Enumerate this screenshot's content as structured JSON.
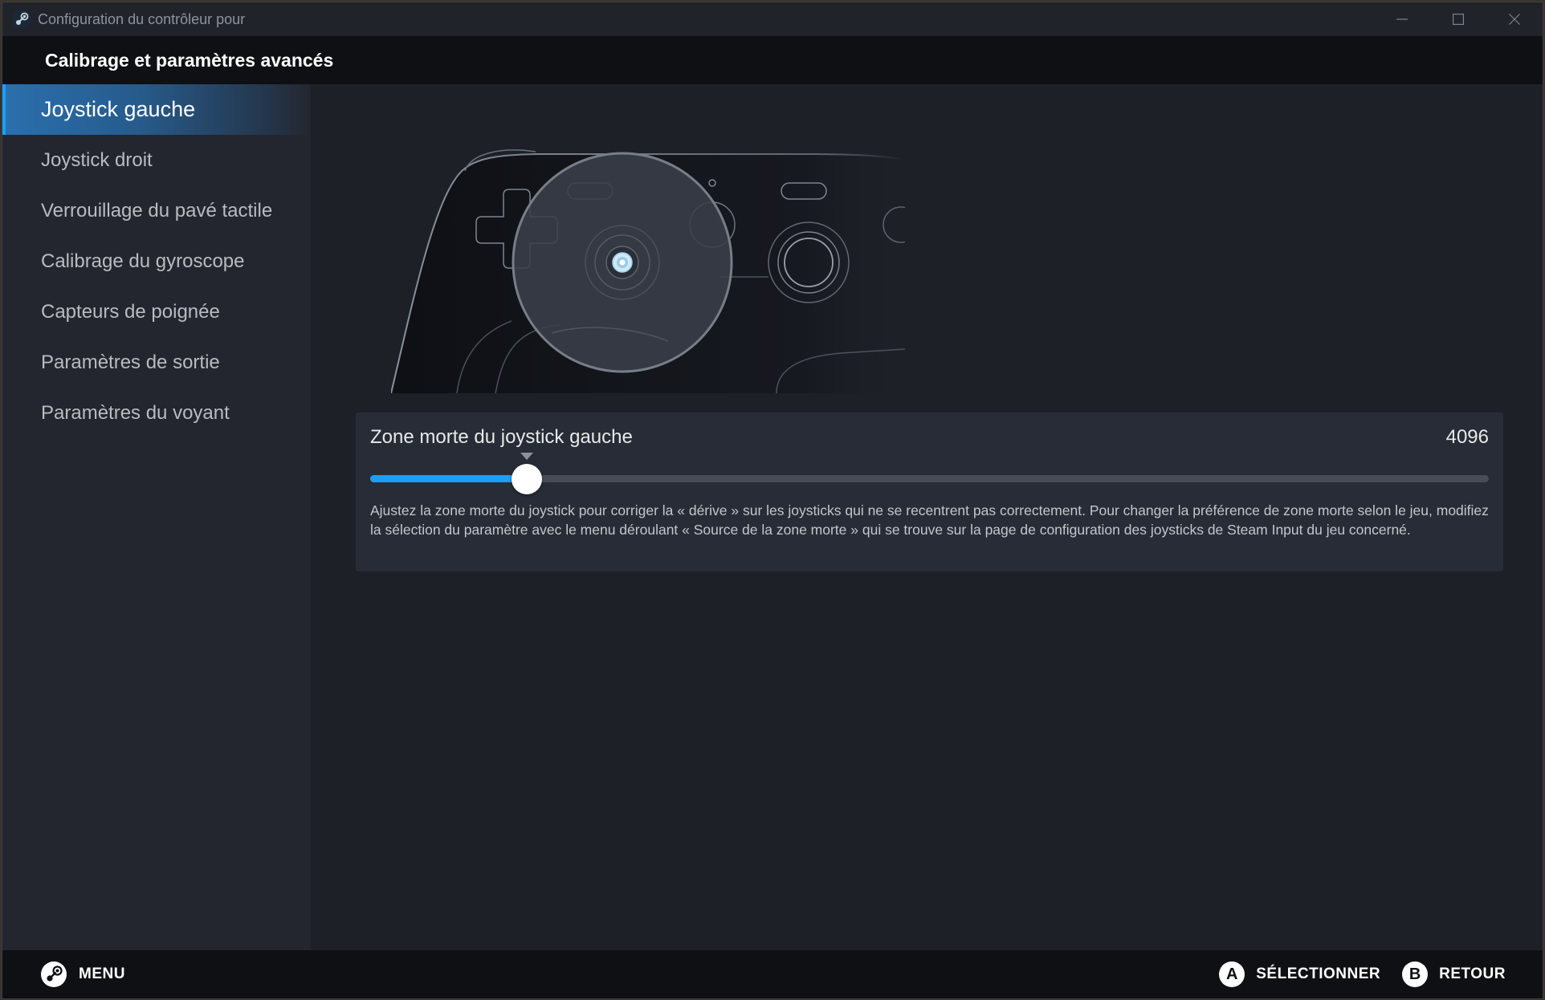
{
  "window": {
    "title": "Configuration du contrôleur pour",
    "icon": "steam-logo-icon",
    "controls": [
      "minimize-icon",
      "maximize-icon",
      "close-icon"
    ]
  },
  "header": {
    "title": "Calibrage et paramètres avancés"
  },
  "sidebar": {
    "items": [
      {
        "label": "Joystick gauche",
        "active": true
      },
      {
        "label": "Joystick droit",
        "active": false
      },
      {
        "label": "Verrouillage du pavé tactile",
        "active": false
      },
      {
        "label": "Calibrage du gyroscope",
        "active": false
      },
      {
        "label": "Capteurs de poignée",
        "active": false
      },
      {
        "label": "Paramètres de sortie",
        "active": false
      },
      {
        "label": "Paramètres du voyant",
        "active": false
      }
    ]
  },
  "main": {
    "illustration": "controller-left-joystick-highlight",
    "setting": {
      "label": "Zone morte du joystick gauche",
      "value": "4096",
      "slider_fraction": 0.14,
      "description": "Ajustez la zone morte du joystick pour corriger la « dérive » sur les joysticks qui ne se recentrent pas correctement. Pour changer la préférence de zone morte selon le jeu, modifiez la sélection du paramètre avec le menu déroulant « Source de la zone morte » qui se trouve sur la page de configuration des joysticks de Steam Input du jeu concerné."
    }
  },
  "footer": {
    "menu_label": "MENU",
    "menu_icon": "steam-button-icon",
    "actions": [
      {
        "button": "A",
        "label": "SÉLECTIONNER"
      },
      {
        "button": "B",
        "label": "RETOUR"
      }
    ]
  },
  "colors": {
    "accent": "#1a9fff",
    "background": "#1d2027",
    "sidebar": "#23262e",
    "bar": "#0f1013",
    "card": "#282c36"
  }
}
